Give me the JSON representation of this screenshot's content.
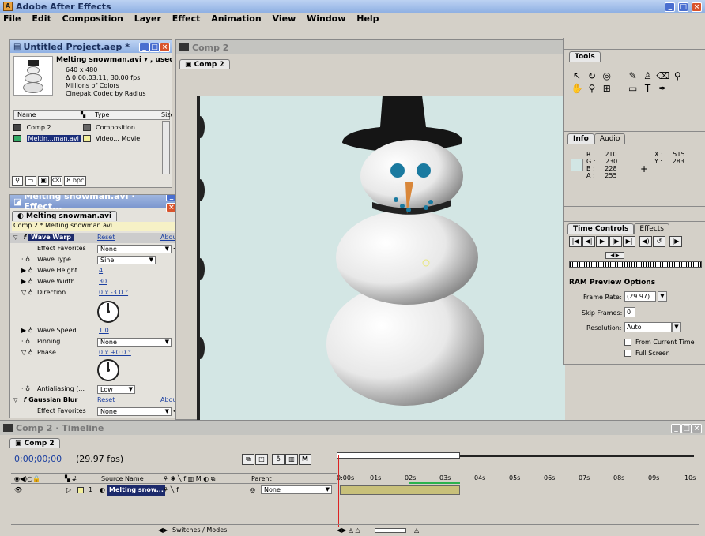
{
  "app": {
    "title": "Adobe After Effects",
    "menu": [
      "File",
      "Edit",
      "Composition",
      "Layer",
      "Effect",
      "Animation",
      "View",
      "Window",
      "Help"
    ]
  },
  "project": {
    "title": "Untitled Project.aep *",
    "footage_name": "Melting snowman.avi ▾ , used",
    "info": [
      "640 x 480",
      "Δ 0:00:03:11, 30.00 fps",
      "Millions of Colors",
      "Cinepak Codec by Radius"
    ],
    "headers": {
      "name": "Name",
      "type": "Type",
      "size": "Size"
    },
    "items": [
      {
        "name": "Comp 2",
        "type": "Composition"
      },
      {
        "name": "Meltin...man.avi",
        "type": "Video... Movie"
      }
    ],
    "bpc": "8 bpc"
  },
  "effects": {
    "title": "Melting snowman.avi · Effect...",
    "tab": "Melting snowman.avi",
    "subtitle": "Comp 2 * Melting snowman.avi",
    "wave_warp": {
      "name": "Wave Warp",
      "reset": "Reset",
      "about": "About...",
      "favorites_label": "Effect Favorites",
      "favorites_value": "None",
      "wave_type_label": "Wave Type",
      "wave_type_value": "Sine",
      "wave_height_label": "Wave Height",
      "wave_height_value": "4",
      "wave_width_label": "Wave Width",
      "wave_width_value": "30",
      "direction_label": "Direction",
      "direction_value": "0 x -3.0 °",
      "wave_speed_label": "Wave Speed",
      "wave_speed_value": "1.0",
      "pinning_label": "Pinning",
      "pinning_value": "None",
      "phase_label": "Phase",
      "phase_value": "0 x +0.0 °",
      "antialias_label": "Antialiasing (...",
      "antialias_value": "Low"
    },
    "gaussian": {
      "name": "Gaussian Blur",
      "reset": "Reset",
      "about": "About...",
      "favorites_label": "Effect Favorites",
      "favorites_value": "None"
    }
  },
  "comp": {
    "title": "Comp 2",
    "tab": "Comp 2"
  },
  "tools": {
    "title": "Tools"
  },
  "info": {
    "tabs": [
      "Info",
      "Audio"
    ],
    "r_label": "R :",
    "r": "210",
    "g_label": "G :",
    "g": "230",
    "b_label": "B :",
    "b": "228",
    "a_label": "A :",
    "a": "255",
    "x_label": "X :",
    "x": "515",
    "y_label": "Y :",
    "y": "283",
    "swatch": "#d2e6e4"
  },
  "time_controls": {
    "tabs": [
      "Time Controls",
      "Effects"
    ],
    "ram_title": "RAM Preview Options",
    "frame_rate_label": "Frame Rate:",
    "frame_rate_value": "(29.97)",
    "skip_label": "Skip Frames:",
    "skip_value": "0",
    "resolution_label": "Resolution:",
    "resolution_value": "Auto",
    "from_current": "From Current Time",
    "full_screen": "Full Screen"
  },
  "timeline": {
    "title": "Comp 2 · Timeline",
    "tab": "Comp 2",
    "timecode": "0;00;00;00",
    "fps": "(29.97 fps)",
    "source_header": "Source Name",
    "parent_header": "Parent",
    "layer_num": "1",
    "layer_name": "Melting snow...",
    "parent_value": "None",
    "ruler": [
      "0:00s",
      "01s",
      "02s",
      "03s",
      "04s",
      "05s",
      "06s",
      "07s",
      "08s",
      "09s",
      "10s"
    ],
    "switches_label": "Switches / Modes"
  },
  "colors": {
    "titlebar": "#4a6fd0",
    "comp_bg": "#d3e6e4",
    "layer_bar": "#c8c07a",
    "work_area": "#2bb24c"
  }
}
